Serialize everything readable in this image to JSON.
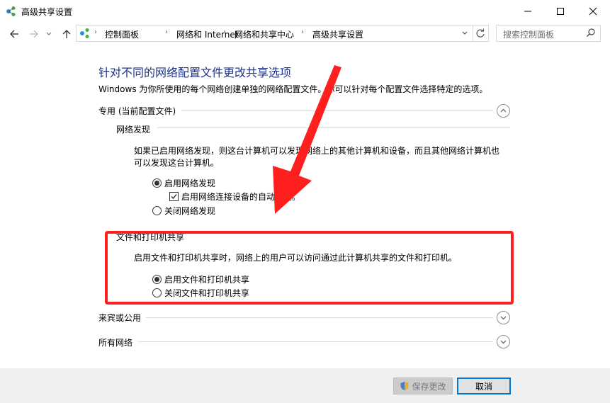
{
  "window": {
    "title": "高级共享设置"
  },
  "nav": {
    "breadcrumbs": [
      "控制面板",
      "网络和 Internet",
      "网络和共享中心",
      "高级共享设置"
    ],
    "search_placeholder": "搜索控制面板"
  },
  "content": {
    "heading": "针对不同的网络配置文件更改共享选项",
    "intro": "Windows 为你所使用的每个网络创建单独的网络配置文件。你可以针对每个配置文件选择特定的选项。",
    "private_profile": {
      "label": "专用 (当前配置文件)",
      "expanded": true,
      "network_discovery": {
        "label": "网络发现",
        "description": "如果已启用网络发现，则这台计算机可以发现网络上的其他计算机和设备，而且其他网络计算机也可以发现这台计算机。",
        "options": {
          "on": "启用网络发现",
          "auto_setup": "启用网络连接设备的自动设置。",
          "off": "关闭网络发现"
        },
        "selected": "on",
        "auto_setup_checked": true
      },
      "file_printer_sharing": {
        "label": "文件和打印机共享",
        "description": "启用文件和打印机共享时，网络上的用户可以访问通过此计算机共享的文件和打印机。",
        "options": {
          "on": "启用文件和打印机共享",
          "off": "关闭文件和打印机共享"
        },
        "selected": "on"
      }
    },
    "guest_profile": {
      "label": "来宾或公用",
      "expanded": false
    },
    "all_networks": {
      "label": "所有网络",
      "expanded": false
    }
  },
  "footer": {
    "save_label": "保存更改",
    "cancel_label": "取消"
  },
  "colors": {
    "heading": "#1e3287",
    "annotation_red": "#ff1f1f",
    "arrow_red": "#ff1f1f",
    "focus_blue": "#0078d7"
  }
}
